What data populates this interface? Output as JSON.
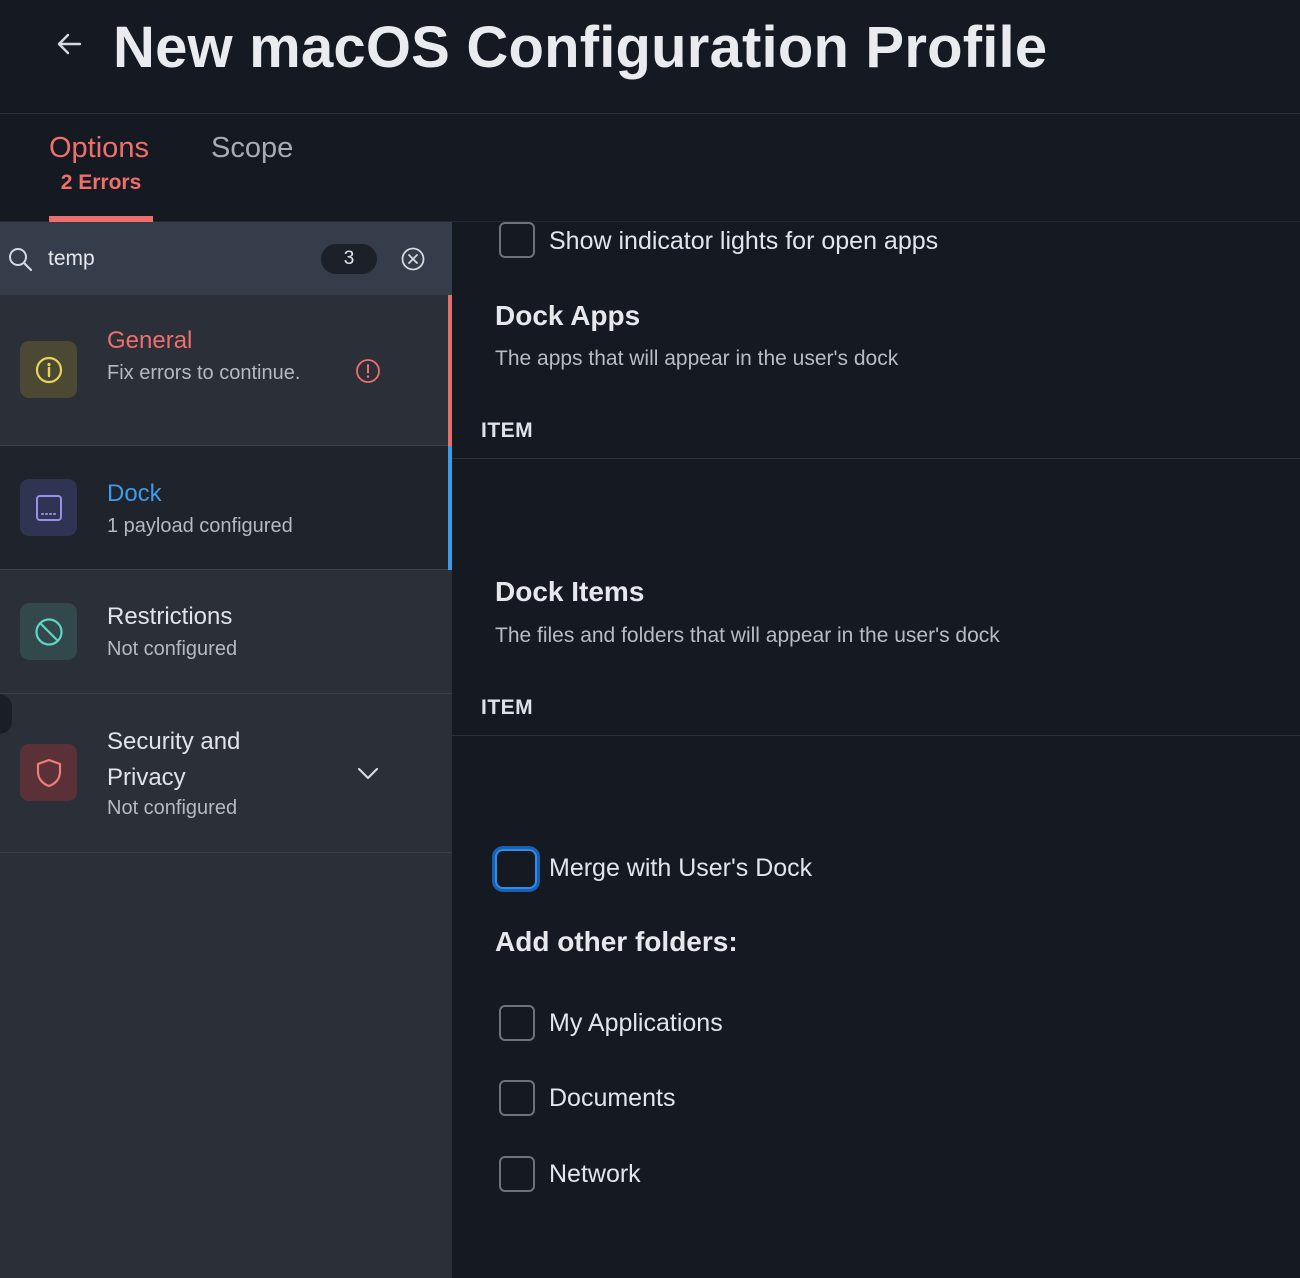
{
  "header": {
    "title": "New macOS Configuration Profile",
    "back_icon": "arrow-left-icon"
  },
  "tabs": {
    "options": {
      "label": "Options",
      "errors": "2 Errors"
    },
    "scope": {
      "label": "Scope"
    }
  },
  "search": {
    "value": "temp",
    "count": "3"
  },
  "sidebar": {
    "items": [
      {
        "title": "General",
        "subtitle": "Fix errors to continue.",
        "icon": "info-icon",
        "status": "error"
      },
      {
        "title": "Dock",
        "subtitle": "1 payload configured",
        "icon": "dock-icon",
        "status": "selected"
      },
      {
        "title": "Restrictions",
        "subtitle": "Not configured",
        "icon": "prohibited-icon"
      },
      {
        "title": "Security and Privacy",
        "subtitle": "Not configured",
        "icon": "shield-icon"
      }
    ]
  },
  "main": {
    "indicator_label": "Show indicator lights for open apps",
    "dock_apps": {
      "title": "Dock Apps",
      "description": "The apps that will appear in the user's dock",
      "column": "ITEM"
    },
    "dock_items": {
      "title": "Dock Items",
      "description": "The files and folders that will appear in the user's dock",
      "column": "ITEM"
    },
    "merge_label": "Merge with User's Dock",
    "folders_title": "Add other folders:",
    "folders": [
      "My Applications",
      "Documents",
      "Network"
    ]
  },
  "colors": {
    "error": "#ef6f6c",
    "accent": "#3f9ae8",
    "background": "#151922",
    "sidebar": "#2b2f38"
  }
}
